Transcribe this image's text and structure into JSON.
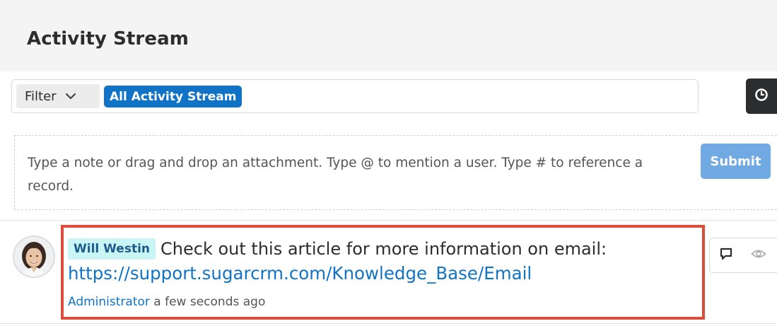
{
  "header": {
    "title": "Activity Stream"
  },
  "filter": {
    "label": "Filter",
    "active_filter": "All Activity Stream"
  },
  "composer": {
    "placeholder": "Type a note or drag and drop an attachment. Type @ to mention a user. Type # to reference a record.",
    "submit_label": "Submit"
  },
  "post": {
    "mentioned_user": "Will Westin",
    "text": "Check out this article for more information on email:",
    "link": "https://support.sugarcrm.com/Knowledge_Base/Email",
    "author": "Administrator",
    "time": "a few seconds ago"
  },
  "colors": {
    "accent": "#1173c6",
    "highlight": "#dc4d3b",
    "submit_disabled": "#71aae3",
    "tag_bg": "#c9f6f5",
    "header_bg": "#f4f4f4"
  },
  "icons": {
    "filter_chevron": "chevron-down-icon",
    "timeline": "clock-icon",
    "comment": "comment-icon",
    "preview": "eye-icon"
  }
}
